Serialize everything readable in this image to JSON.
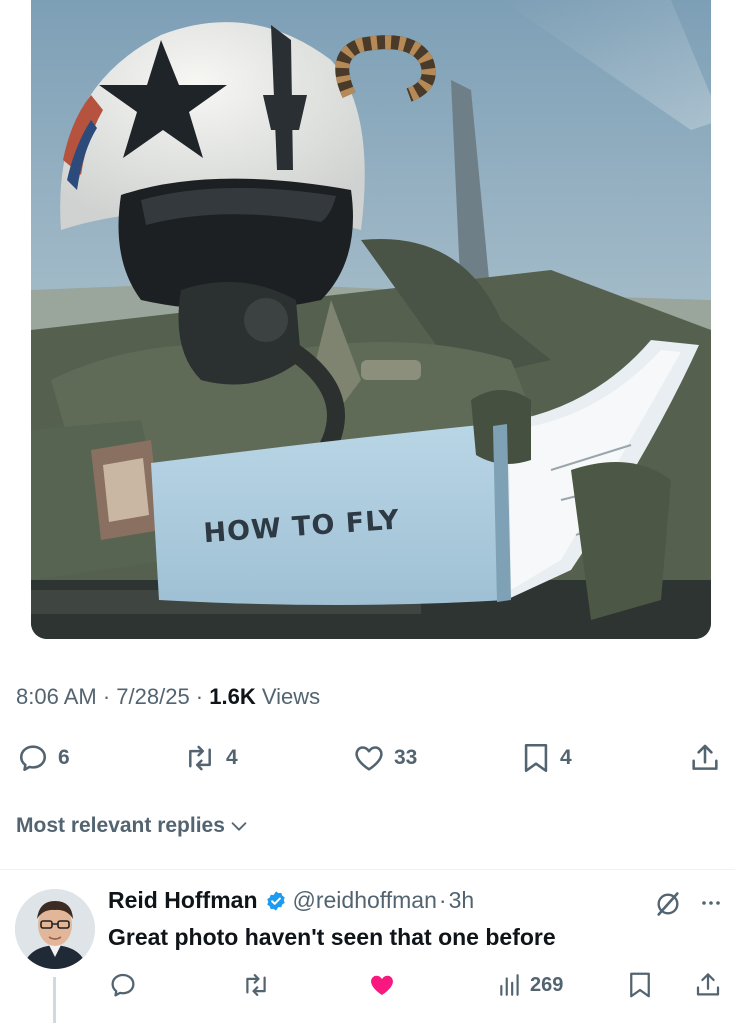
{
  "photo": {
    "caption": "HOW TO FLY"
  },
  "meta": {
    "time": "8:06 AM",
    "sep1": " · ",
    "date": "7/28/25",
    "sep2": " · ",
    "views_count": "1.6K",
    "views_label": " Views"
  },
  "actions": {
    "replies": "6",
    "reposts": "4",
    "likes": "33",
    "bookmarks": "4"
  },
  "replies_section": {
    "sort_label": "Most relevant replies"
  },
  "reply": {
    "name": "Reid Hoffman",
    "handle": "@reidhoffman",
    "dot": "·",
    "time": "3h",
    "text": "Great photo haven't seen that one before",
    "views": "269",
    "like_color": "#f91880"
  },
  "colors": {
    "verified": "#1d9bf0",
    "secondary_text": "#536471",
    "primary_text": "#0f1419"
  }
}
